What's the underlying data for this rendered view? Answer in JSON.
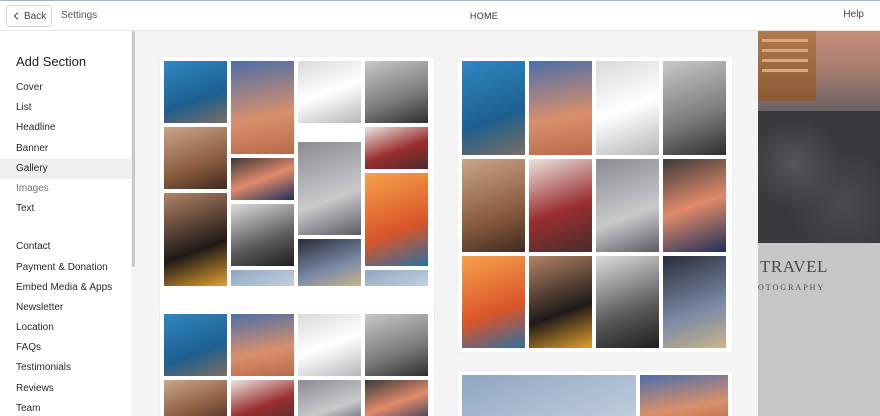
{
  "topbar": {
    "back_label": "Back",
    "settings_label": "Settings",
    "page_name": "HOME",
    "help_label": "Help"
  },
  "sidebar": {
    "title": "Add Section",
    "groups": [
      [
        "Cover",
        "List",
        "Headline",
        "Banner",
        "Gallery",
        "Images",
        "Text"
      ],
      [
        "Contact",
        "Payment & Donation",
        "Embed Media & Apps",
        "Newsletter",
        "Location",
        "FAQs",
        "Testimonials",
        "Reviews",
        "Team"
      ]
    ],
    "active_item": "Gallery",
    "muted_items": [
      "Images"
    ]
  },
  "preview": {
    "title": "TRAVEL",
    "subtitle": "OTOGRAPHY"
  },
  "colors": {
    "canvas_bg": "#f4f4f4",
    "active_bg": "#efefef",
    "preview_bg": "#c6c6c6"
  }
}
